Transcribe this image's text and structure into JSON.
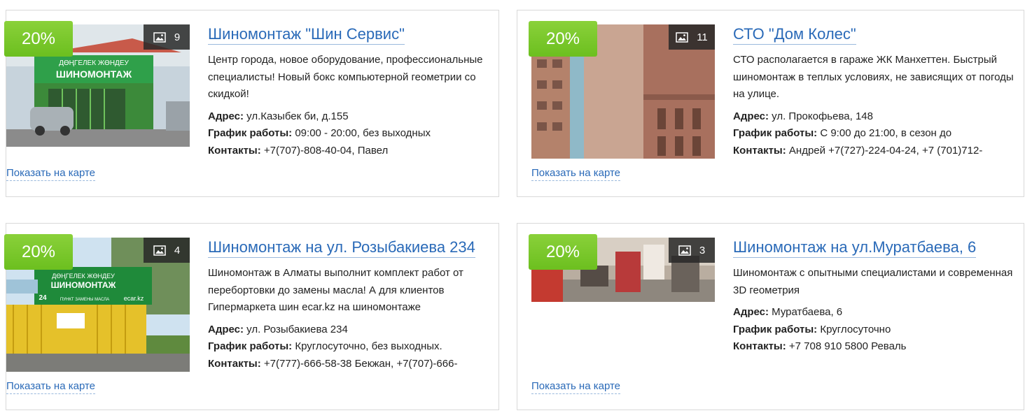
{
  "listings": [
    {
      "discount": "20%",
      "photo_count": "9",
      "title": "Шиномонтаж \"Шин Сервис\"",
      "description": "Центр города, новое оборудование, профессиональные специалисты! Новый бокс компьютерной геометрии со скидкой!",
      "address_label": "Адрес:",
      "address": " ул.Казыбек би, д.155",
      "hours_label": "График работы:",
      "hours": " 09:00 - 20:00, без выходных",
      "contacts_label": "Контакты:",
      "contacts": " +7(707)-808-40-04, Павел",
      "map_link": "Показать на карте",
      "sign_text_top": "ДӨҢГЕЛЕК ЖӨНДЕУ",
      "sign_text_main": "ШИНОМОНТАЖ"
    },
    {
      "discount": "20%",
      "photo_count": "11",
      "title": "СТО \"Дом Колес\"",
      "description": "СТО располагается в гараже ЖК Манхеттен. Быстрый шиномонтаж в теплых условиях, не зависящих от погоды на улице.",
      "address_label": "Адрес:",
      "address": " ул. Прокофьева, 148",
      "hours_label": "График работы:",
      "hours": " С 9:00 до 21:00, в сезон до",
      "contacts_label": "Контакты:",
      "contacts": " Андрей +7(727)-224-04-24, +7 (701)712-",
      "map_link": "Показать на карте"
    },
    {
      "discount": "20%",
      "photo_count": "4",
      "title": "Шиномонтаж на ул. Розыбакиева 234",
      "description": "Шиномонтаж в Алматы выполнит комплект работ от перебортовки до замены масла! А для клиентов Гипермаркета шин ecar.kz на шиномонтаже",
      "address_label": "Адрес:",
      "address": " ул. Розыбакиева 234",
      "hours_label": "График работы:",
      "hours": " Круглосуточно, без выходных.",
      "contacts_label": "Контакты:",
      "contacts": " +7(777)-666-58-38 Бекжан, +7(707)-666-",
      "map_link": "Показать на карте",
      "sign_text_top": "ДӨҢГЕЛЕК ЖӨНДЕУ",
      "sign_text_main": "ШИНОМОНТАЖ",
      "sign_text_24": "24",
      "sign_text_small": "ПУНКТ ЗАМЕНЫ МАСЛА",
      "sign_brand": "ecar.kz"
    },
    {
      "discount": "20%",
      "photo_count": "3",
      "title": "Шиномонтаж на ул.Муратбаева, 6",
      "description": "Шиномонтаж с опытными специалистами и современная 3D геометрия",
      "address_label": "Адрес:",
      "address": " Муратбаева, 6",
      "hours_label": "График работы:",
      "hours": " Круглосуточно",
      "contacts_label": "Контакты:",
      "contacts": " +7 708 910 5800 Реваль",
      "map_link": "Показать на карте"
    }
  ],
  "colors": {
    "discount_green": "#7cc82c",
    "link_blue": "#2a6ab8",
    "border": "#d9d9d9"
  },
  "icons": {
    "photo_count": "image-icon"
  }
}
